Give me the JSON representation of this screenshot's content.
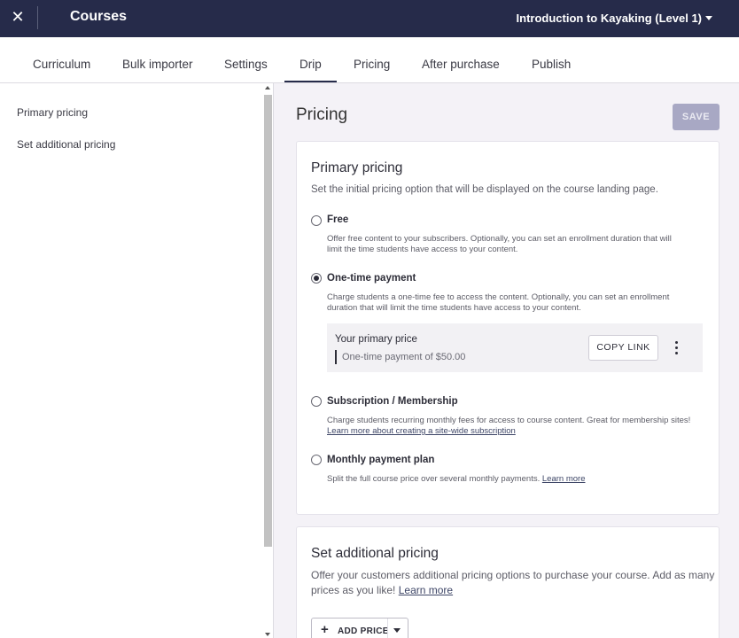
{
  "topbar": {
    "title": "Courses",
    "course_name": "Introduction to Kayaking (Level 1)",
    "close_icon": "close-icon",
    "dropdown_icon": "caret-down-icon"
  },
  "tabs": [
    "Curriculum",
    "Bulk importer",
    "Settings",
    "Drip",
    "Pricing",
    "After purchase",
    "Publish"
  ],
  "active_tab": "Drip",
  "sidebar": {
    "items": [
      "Primary pricing",
      "Set additional pricing"
    ]
  },
  "main": {
    "title": "Pricing",
    "save_label": "SAVE",
    "primary": {
      "heading": "Primary pricing",
      "subtitle": "Set the initial pricing option that will be displayed on the course landing page.",
      "options": [
        {
          "label": "Free",
          "desc1": "Offer free content to your subscribers. Optionally, you can set an enrollment duration that will",
          "desc2": "limit the time students have access to your content.",
          "selected": false
        },
        {
          "label": "One-time payment",
          "desc1": "Charge students a one-time fee to access the content. Optionally, you can set an enrollment",
          "desc2": "duration that will limit the time students have access to your content.",
          "selected": true
        },
        {
          "label": "Subscription / Membership",
          "desc1": "Charge students recurring monthly fees for access to course content. Great for membership sites!",
          "link": "Learn more about creating a site-wide subscription",
          "selected": false
        },
        {
          "label": "Monthly payment plan",
          "desc1": "Split the full course price over several monthly payments.",
          "link": "Learn more",
          "selected": false
        }
      ],
      "price_box": {
        "title": "Your primary price",
        "value": "One-time payment of $50.00",
        "copy_label": "COPY LINK",
        "more_icon": "kebab-menu-icon"
      }
    },
    "additional": {
      "heading": "Set additional pricing",
      "text1": "Offer your customers additional pricing options to purchase your course. Add as many",
      "text2": "prices as you like!",
      "link": "Learn more",
      "add_label": "ADD PRICE",
      "plus_icon": "plus-icon",
      "dropdown_icon": "caret-down-icon"
    }
  },
  "colors": {
    "topbar": "#262b4a",
    "save_disabled": "#a8a8c4",
    "background": "#f4f2f7"
  }
}
